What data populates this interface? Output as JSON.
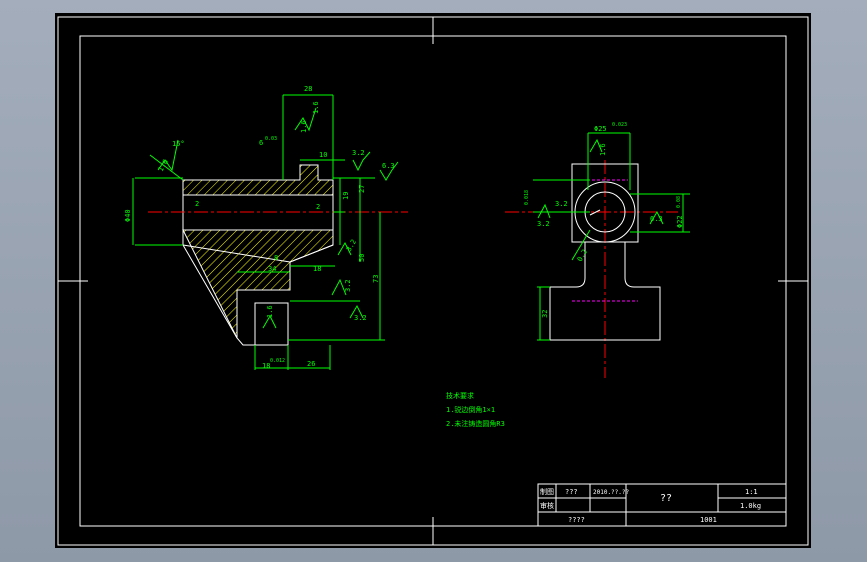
{
  "colors": {
    "background": "#000000",
    "frame": "#ffffff",
    "dimension": "#00ff00",
    "centerline": "#ff0000",
    "hatch": "#ffff00",
    "hidden": "#ff00ff",
    "note": "#00ff00",
    "outer": "#9aa5b3"
  },
  "front_view": {
    "dims": {
      "w28": "28",
      "r16a": "1.6",
      "r16b": "1.6",
      "tol10": "6",
      "tol10sup": "0.03",
      "w10": "10",
      "r32a": "3.2",
      "r63": "6.3",
      "angle15": "15°",
      "r16c": "1.6",
      "d2a": "2",
      "d2b": "2",
      "d19": "19",
      "d27": "27",
      "dia40": "Φ40",
      "d50": "50",
      "d73": "73",
      "w8": "8",
      "w34": "34",
      "w18": "18",
      "r32b": "3.2",
      "r32c": "3.2",
      "r32d": "3.2",
      "r16d": "1.6",
      "tol18": "18",
      "tol18sup": "0.012",
      "w26": "26"
    }
  },
  "side_view": {
    "dims": {
      "dia25": "Φ25",
      "dia25sup": "0.023",
      "r16": "1.6",
      "left_tol": "0.018",
      "r32": "3.2",
      "r32b": "3.2",
      "r63": "6.3",
      "dia22": "Φ22",
      "dia22sup": "0.08",
      "r16b": "0.2",
      "d32": "32"
    }
  },
  "notes": {
    "title": "技术要求",
    "line1": "1.锐边倒角1×1",
    "line2": "2.未注铸造圆角R3"
  },
  "title_block": {
    "row1_label": "制图",
    "row1_name": "???",
    "row1_date": "2010.??.??",
    "part_name": "??",
    "scale": "1:1",
    "row2_label": "审核",
    "weight": "1.0kg",
    "school": "????",
    "drawing_no": "1001"
  }
}
